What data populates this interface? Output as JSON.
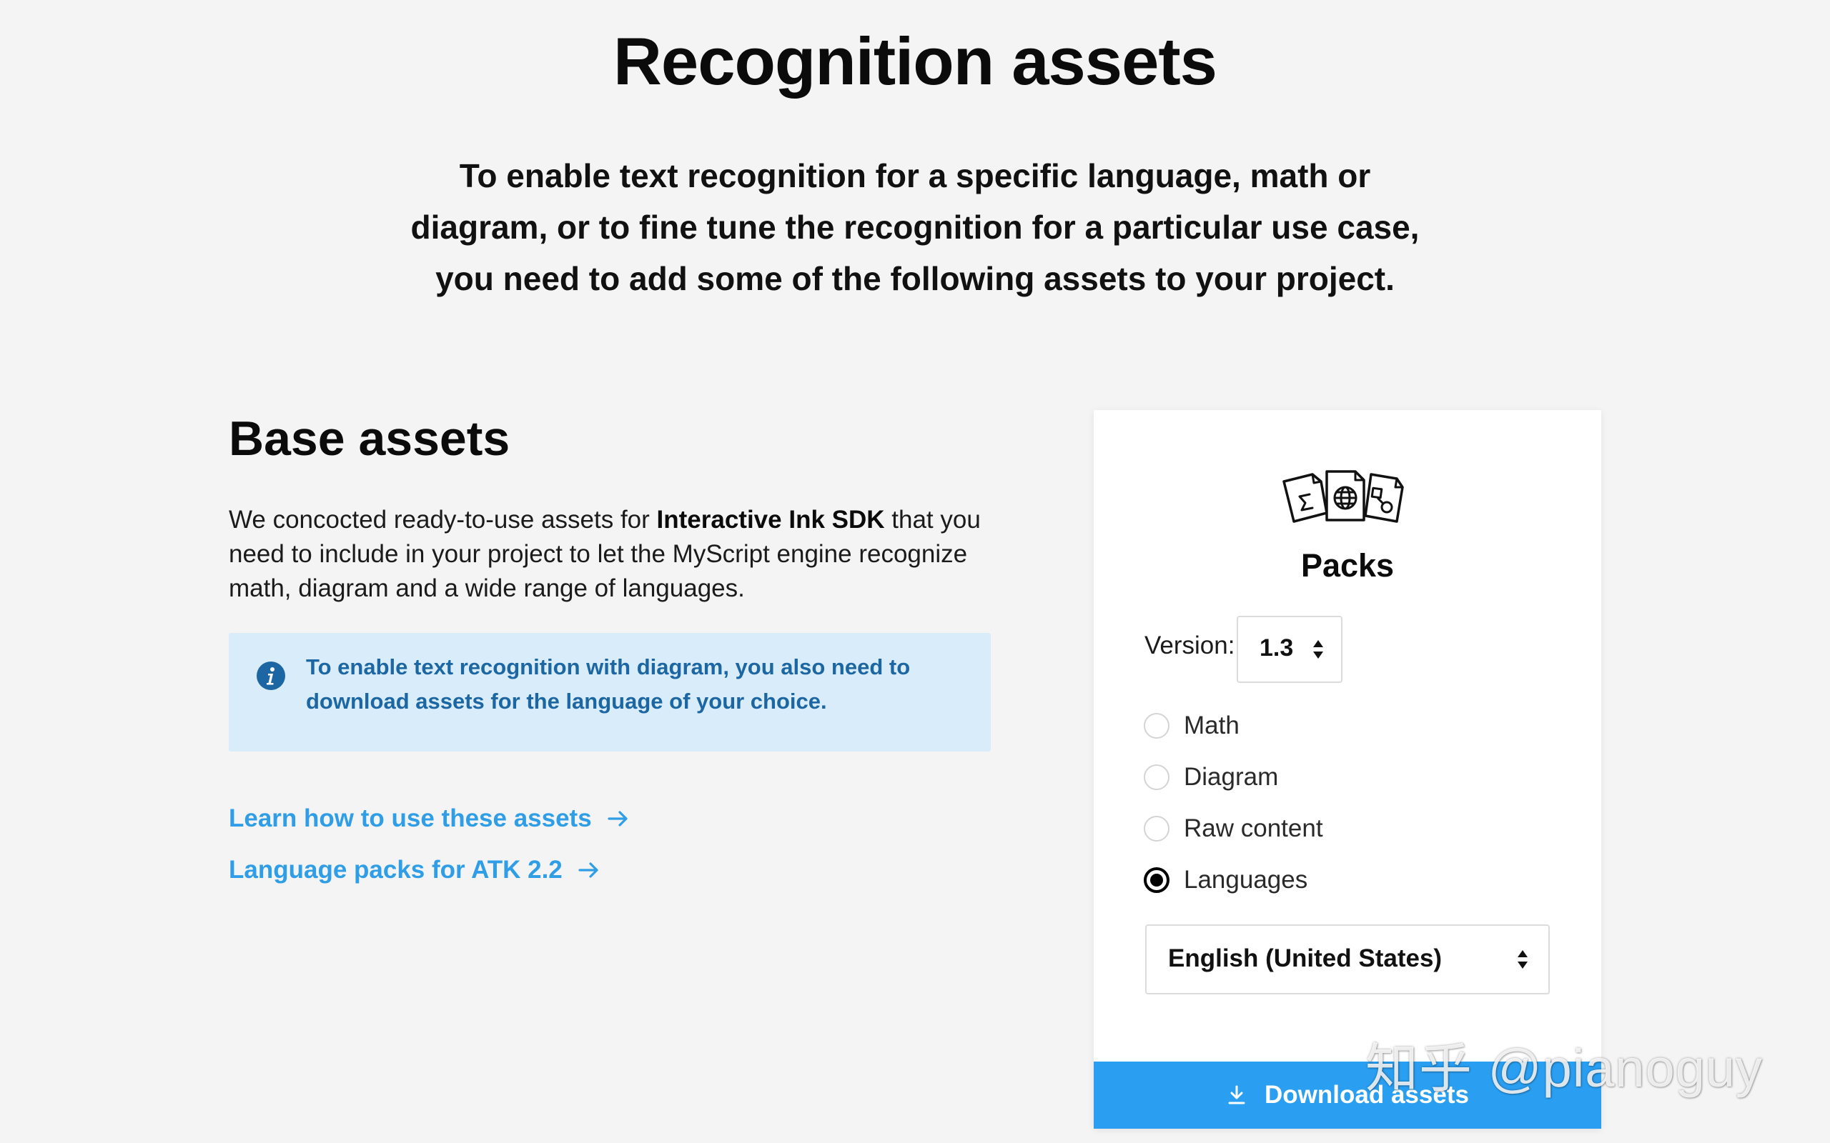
{
  "header": {
    "title": "Recognition assets",
    "intro_lines": [
      "To enable text recognition for a specific language, math or",
      "diagram, or to fine tune the recognition for a particular use case,",
      "you need to add some of the following assets to your project."
    ]
  },
  "base_assets": {
    "title": "Base assets",
    "desc": {
      "line1_pre": "We concocted ready-to-use assets for ",
      "line1_bold": "Interactive Ink SDK",
      "line1_post": " that you",
      "line2": "need to include in your project to let the MyScript engine recognize",
      "line3": "math, diagram and a wide range of languages."
    },
    "notice": {
      "icon": "info-icon",
      "lines": [
        "To enable text recognition with diagram, you also need to",
        "download assets for the language of your choice."
      ]
    },
    "links": [
      {
        "label": "Learn how to use these assets",
        "icon": "arrow-right-icon"
      },
      {
        "label": "Language packs for ATK 2.2",
        "icon": "arrow-right-icon"
      }
    ]
  },
  "packs_card": {
    "icon": "packs-documents-icon",
    "title": "Packs",
    "version_label": "Version:",
    "version_value": "1.3",
    "options": [
      {
        "label": "Math",
        "checked": false
      },
      {
        "label": "Diagram",
        "checked": false
      },
      {
        "label": "Raw content",
        "checked": false
      },
      {
        "label": "Languages",
        "checked": true
      }
    ],
    "language_value": "English (United States)",
    "download_label": "Download assets",
    "download_icon": "download-icon"
  },
  "watermark": "知乎 @pianoguy",
  "colors": {
    "background": "#f4f4f4",
    "link": "#2f9ee6",
    "notice_bg": "#d9ecf9",
    "notice_text": "#1c67a3",
    "button": "#2a9ff2"
  }
}
